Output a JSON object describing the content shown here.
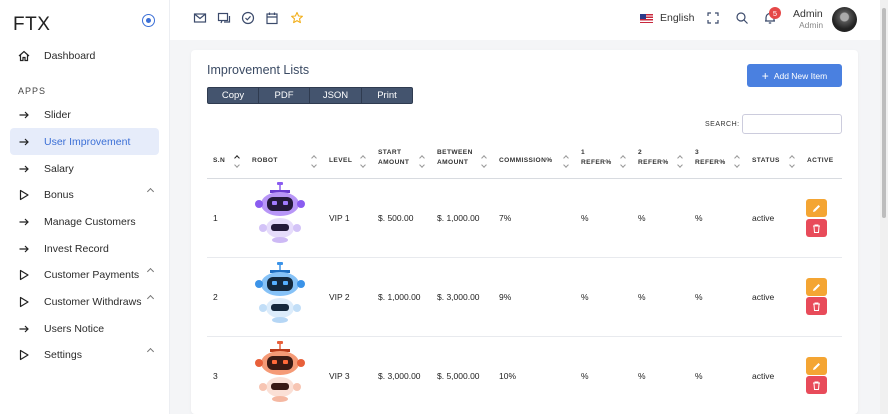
{
  "brand": "FTX",
  "sidebar": {
    "section_label": "APPS",
    "items": [
      {
        "label": "Dashboard",
        "icon": "home-icon"
      },
      {
        "label": "Slider",
        "icon": "arrow-right-icon"
      },
      {
        "label": "User Improvement",
        "icon": "arrow-right-icon",
        "active": true
      },
      {
        "label": "Salary",
        "icon": "arrow-right-icon"
      },
      {
        "label": "Bonus",
        "icon": "play-icon",
        "expandable": true
      },
      {
        "label": "Manage Customers",
        "icon": "arrow-right-icon"
      },
      {
        "label": "Invest Record",
        "icon": "arrow-right-icon"
      },
      {
        "label": "Customer Payments",
        "icon": "play-icon",
        "expandable": true
      },
      {
        "label": "Customer Withdraws",
        "icon": "play-icon",
        "expandable": true
      },
      {
        "label": "Users Notice",
        "icon": "arrow-right-icon"
      },
      {
        "label": "Settings",
        "icon": "play-icon",
        "expandable": true
      }
    ]
  },
  "topbar": {
    "icons": [
      "mail-icon",
      "chat-icon",
      "check-circle-icon",
      "calendar-icon",
      "star-icon"
    ],
    "language": "English",
    "notification_count": "5",
    "admin_name": "Admin",
    "admin_role": "Admin"
  },
  "card": {
    "title": "Improvement Lists",
    "export_buttons": [
      "Copy",
      "PDF",
      "JSON",
      "Print"
    ],
    "add_button": "Add New Item",
    "search_label": "SEARCH:",
    "search_value": ""
  },
  "table": {
    "headers": [
      {
        "l1": "S.N",
        "l2": ""
      },
      {
        "l1": "ROBOT",
        "l2": ""
      },
      {
        "l1": "LEVEL",
        "l2": ""
      },
      {
        "l1": "START",
        "l2": "AMOUNT"
      },
      {
        "l1": "BETWEEN",
        "l2": "AMOUNT"
      },
      {
        "l1": "COMMISSION%",
        "l2": ""
      },
      {
        "l1": "1",
        "l2": "REFER%"
      },
      {
        "l1": "2",
        "l2": "REFER%"
      },
      {
        "l1": "3",
        "l2": "REFER%"
      },
      {
        "l1": "STATUS",
        "l2": ""
      },
      {
        "l1": "ACTIVE",
        "l2": ""
      }
    ],
    "rows": [
      {
        "sn": "1",
        "level": "VIP 1",
        "start": "$. 500.00",
        "between": "$. 1,000.00",
        "commission": "7%",
        "r1": "%",
        "r2": "%",
        "r3": "%",
        "status": "active",
        "robot_color": "#8a5cf0"
      },
      {
        "sn": "2",
        "level": "VIP 2",
        "start": "$. 1,000.00",
        "between": "$. 3,000.00",
        "commission": "9%",
        "r1": "%",
        "r2": "%",
        "r3": "%",
        "status": "active",
        "robot_color": "#3b93e8"
      },
      {
        "sn": "3",
        "level": "VIP 3",
        "start": "$. 3,000.00",
        "between": "$. 5,000.00",
        "commission": "10%",
        "r1": "%",
        "r2": "%",
        "r3": "%",
        "status": "active",
        "robot_color": "#e8603a"
      }
    ]
  },
  "colors": {
    "accent": "#4a80e0",
    "edit": "#f4a533",
    "delete": "#e84b5a",
    "export_bg": "#44546e"
  }
}
